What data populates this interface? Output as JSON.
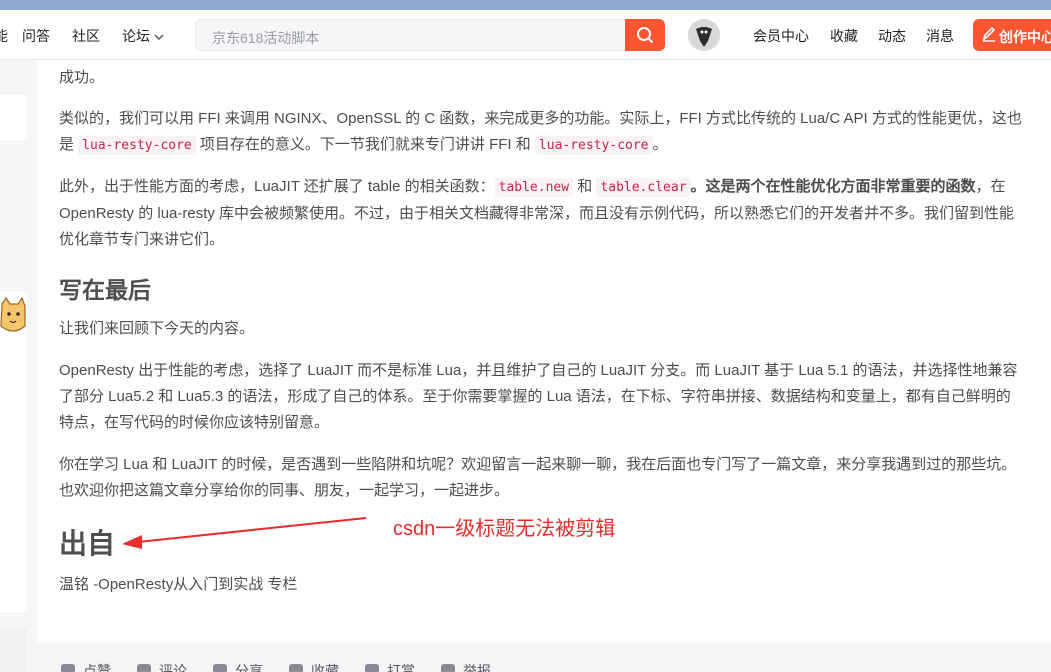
{
  "nav": {
    "partial_item": "能",
    "items": [
      {
        "label": "问答"
      },
      {
        "label": "社区"
      },
      {
        "label": "论坛"
      }
    ],
    "search": {
      "placeholder": "京东618活动脚本"
    },
    "right_items": [
      {
        "label": "会员中心"
      },
      {
        "label": "收藏"
      },
      {
        "label": "动态"
      },
      {
        "label": "消息"
      }
    ],
    "create_label": "创作中心"
  },
  "article": {
    "top_fragment": "成功。",
    "p1": {
      "before_code1": "类似的，我们可以用 FFI 来调用 NGINX、OpenSSL 的 C 函数，来完成更多的功能。实际上，FFI 方式比传统的 Lua/C API 方式的性能更优，这也是 ",
      "code1": "lua-resty-core",
      "between": " 项目存在的意义。下一节我们就来专门讲讲 FFI 和 ",
      "code2": "lua-resty-core",
      "after": "。"
    },
    "p2": {
      "before_code1": "此外，出于性能方面的考虑，LuaJIT 还扩展了 table 的相关函数：",
      "code1": "table.new",
      "and": " 和 ",
      "code2": "table.clear",
      "bold": "。这是两个在性能优化方面非常重要的函数",
      "after": "，在 OpenResty 的 lua-resty 库中会被频繁使用。不过，由于相关文档藏得非常深，而且没有示例代码，所以熟悉它们的开发者并不多。我们留到性能优化章节专门来讲它们。"
    },
    "h2": "写在最后",
    "p3": "让我们来回顾下今天的内容。",
    "p4": "OpenResty 出于性能的考虑，选择了 LuaJIT 而不是标准 Lua，并且维护了自己的 LuaJIT 分支。而 LuaJIT 基于 Lua 5.1 的语法，并选择性地兼容了部分 Lua5.2 和 Lua5.3 的语法，形成了自己的体系。至于你需要掌握的 Lua 语法，在下标、字符串拼接、数据结构和变量上，都有自己鲜明的特点，在写代码的时候你应该特别留意。",
    "p5": "你在学习 Lua 和 LuaJIT 的时候，是否遇到一些陷阱和坑呢？欢迎留言一起来聊一聊，我在后面也专门写了一篇文章，来分享我遇到过的那些坑。也欢迎你把这篇文章分享给你的同事、朋友，一起学习，一起进步。",
    "h1": "出自",
    "source": "温铭 -OpenResty从入门到实战 专栏",
    "annotation": "csdn一级标题无法被剪辑"
  },
  "toolbar": {
    "items": [
      {
        "label": "点赞"
      },
      {
        "label": "评论"
      },
      {
        "label": "分享"
      },
      {
        "label": "收藏"
      },
      {
        "label": "打赏"
      },
      {
        "label": "举报"
      }
    ]
  },
  "colors": {
    "accent": "#fc5531",
    "code_text": "#c7254e",
    "code_bg": "#f9f2f4",
    "annotation": "#e52d2d"
  }
}
